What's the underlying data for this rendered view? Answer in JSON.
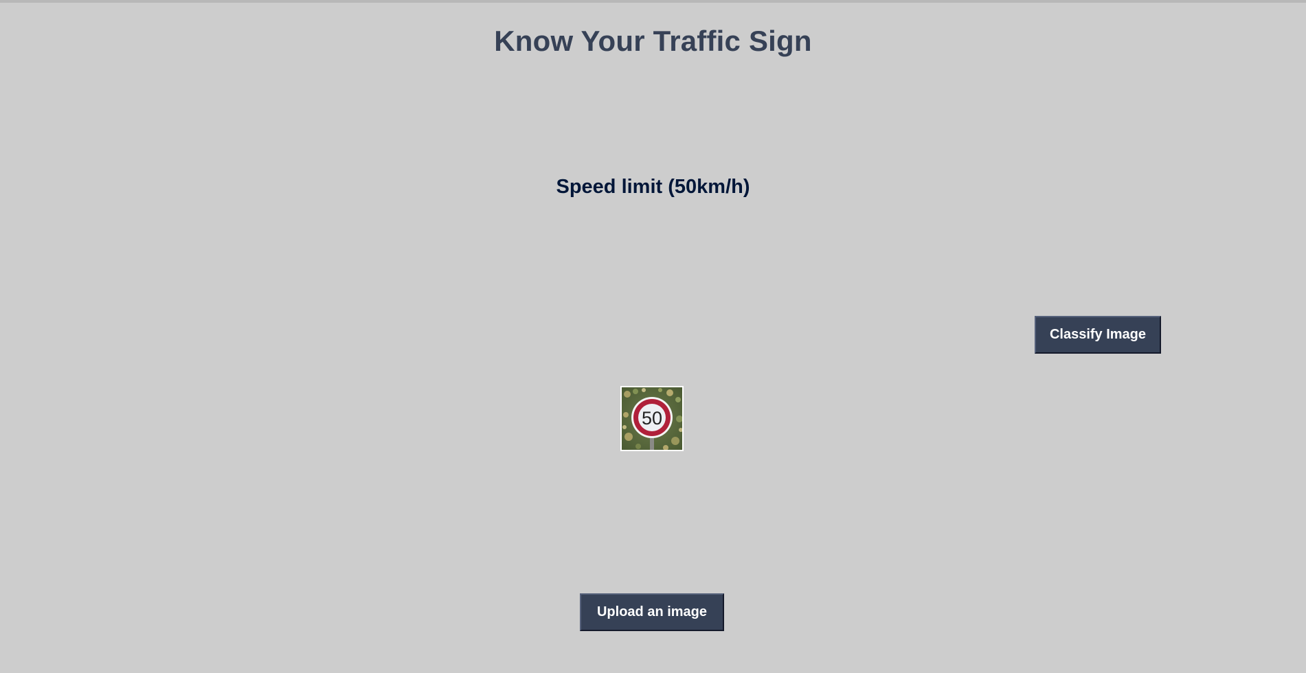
{
  "header": {
    "title": "Know Your Traffic Sign"
  },
  "result": {
    "label": "Speed limit (50km/h)"
  },
  "buttons": {
    "classify_label": "Classify Image",
    "upload_label": "Upload an image"
  },
  "uploaded_image": {
    "sign_number": "50",
    "icon": "speed-limit-sign"
  },
  "colors": {
    "background": "#cdcdcd",
    "button_bg": "#364156",
    "title_text": "#364156",
    "label_text": "#011638",
    "sign_ring": "#b0203a"
  }
}
